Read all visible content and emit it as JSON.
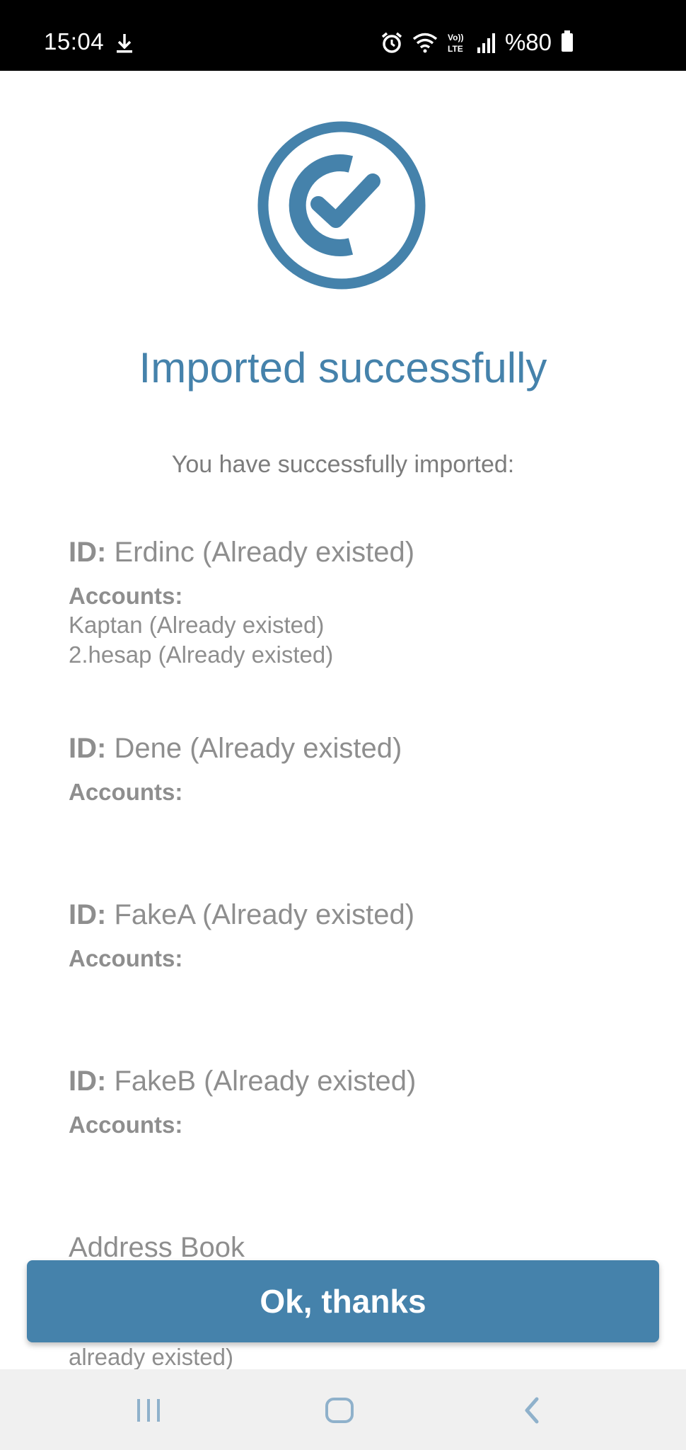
{
  "status_bar": {
    "time": "15:04",
    "battery_text": "%80",
    "volte_label": "Vo))\nLTE"
  },
  "main": {
    "title": "Imported successfully",
    "subtitle": "You have successfully imported:",
    "id_prefix": "ID:",
    "accounts_label": "Accounts:",
    "entries": [
      {
        "id": "Erdinc (Already existed)",
        "accounts": [
          "Kaptan (Already existed)",
          "2.hesap (Already existed)"
        ]
      },
      {
        "id": "Dene (Already existed)",
        "accounts": []
      },
      {
        "id": "FakeA (Already existed)",
        "accounts": []
      },
      {
        "id": "FakeB (Already existed)",
        "accounts": []
      }
    ],
    "address_book_label": "Address Book",
    "address_book_tail": "already existed)"
  },
  "button": {
    "ok_label": "Ok, thanks"
  },
  "colors": {
    "accent": "#4582ab",
    "text_gray": "#8e8e8e",
    "nav_bg": "#f0f0f0"
  },
  "icons": [
    "download-icon",
    "alarm-icon",
    "wifi-icon",
    "volte-icon",
    "signal-icon",
    "battery-icon",
    "success-check-icon",
    "recents-icon",
    "home-icon",
    "back-icon"
  ]
}
